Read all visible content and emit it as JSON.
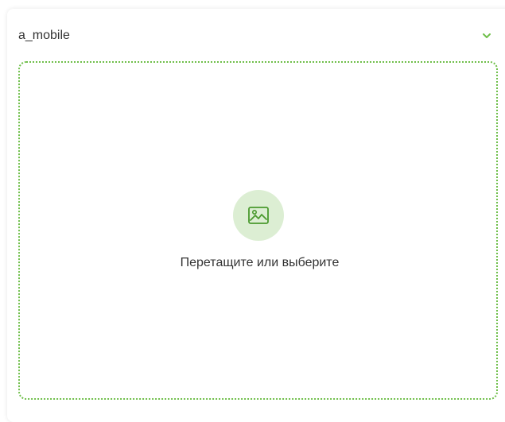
{
  "field": {
    "title": "a_mobile",
    "toggle_icon": "chevron-down-icon"
  },
  "dropzone": {
    "icon": "image-icon",
    "hint": "Перетащите или выберите"
  },
  "colors": {
    "accent": "#6fbf4a",
    "icon_bg": "#dceed3",
    "text": "#333333"
  }
}
